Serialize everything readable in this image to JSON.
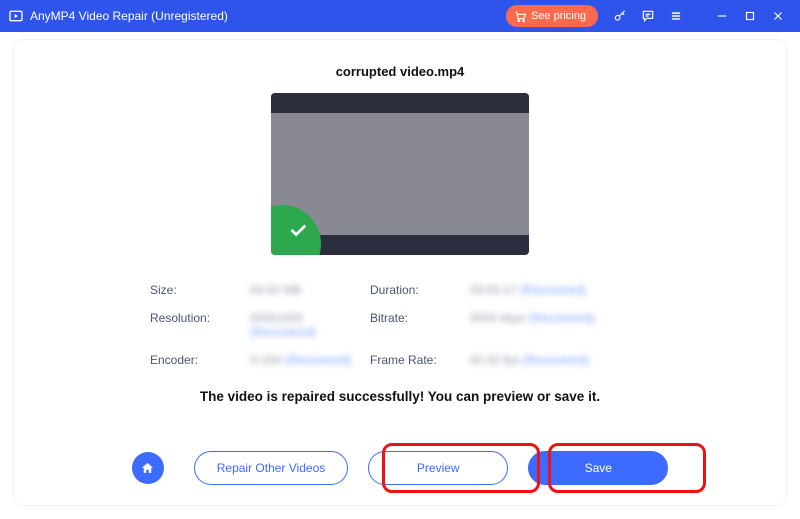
{
  "titlebar": {
    "title": "AnyMP4 Video Repair (Unregistered)",
    "see_pricing": "See pricing"
  },
  "main": {
    "filename": "corrupted video.mp4",
    "info": {
      "size_label": "Size:",
      "size_value": "00.00 MB",
      "duration_label": "Duration:",
      "duration_value": "00:00:17",
      "duration_status": "(Recovered)",
      "resolution_label": "Resolution:",
      "resolution_value": "0000x000",
      "resolution_status": "(Recovered)",
      "bitrate_label": "Bitrate:",
      "bitrate_value": "0000 kbps",
      "bitrate_status": "(Recovered)",
      "encoder_label": "Encoder:",
      "encoder_value": "H.264",
      "encoder_status": "(Recovered)",
      "framerate_label": "Frame Rate:",
      "framerate_value": "00.00 fps",
      "framerate_status": "(Recovered)"
    },
    "success_msg": "The video is repaired successfully! You can preview or save it."
  },
  "actions": {
    "repair_other": "Repair Other Videos",
    "preview": "Preview",
    "save": "Save"
  }
}
